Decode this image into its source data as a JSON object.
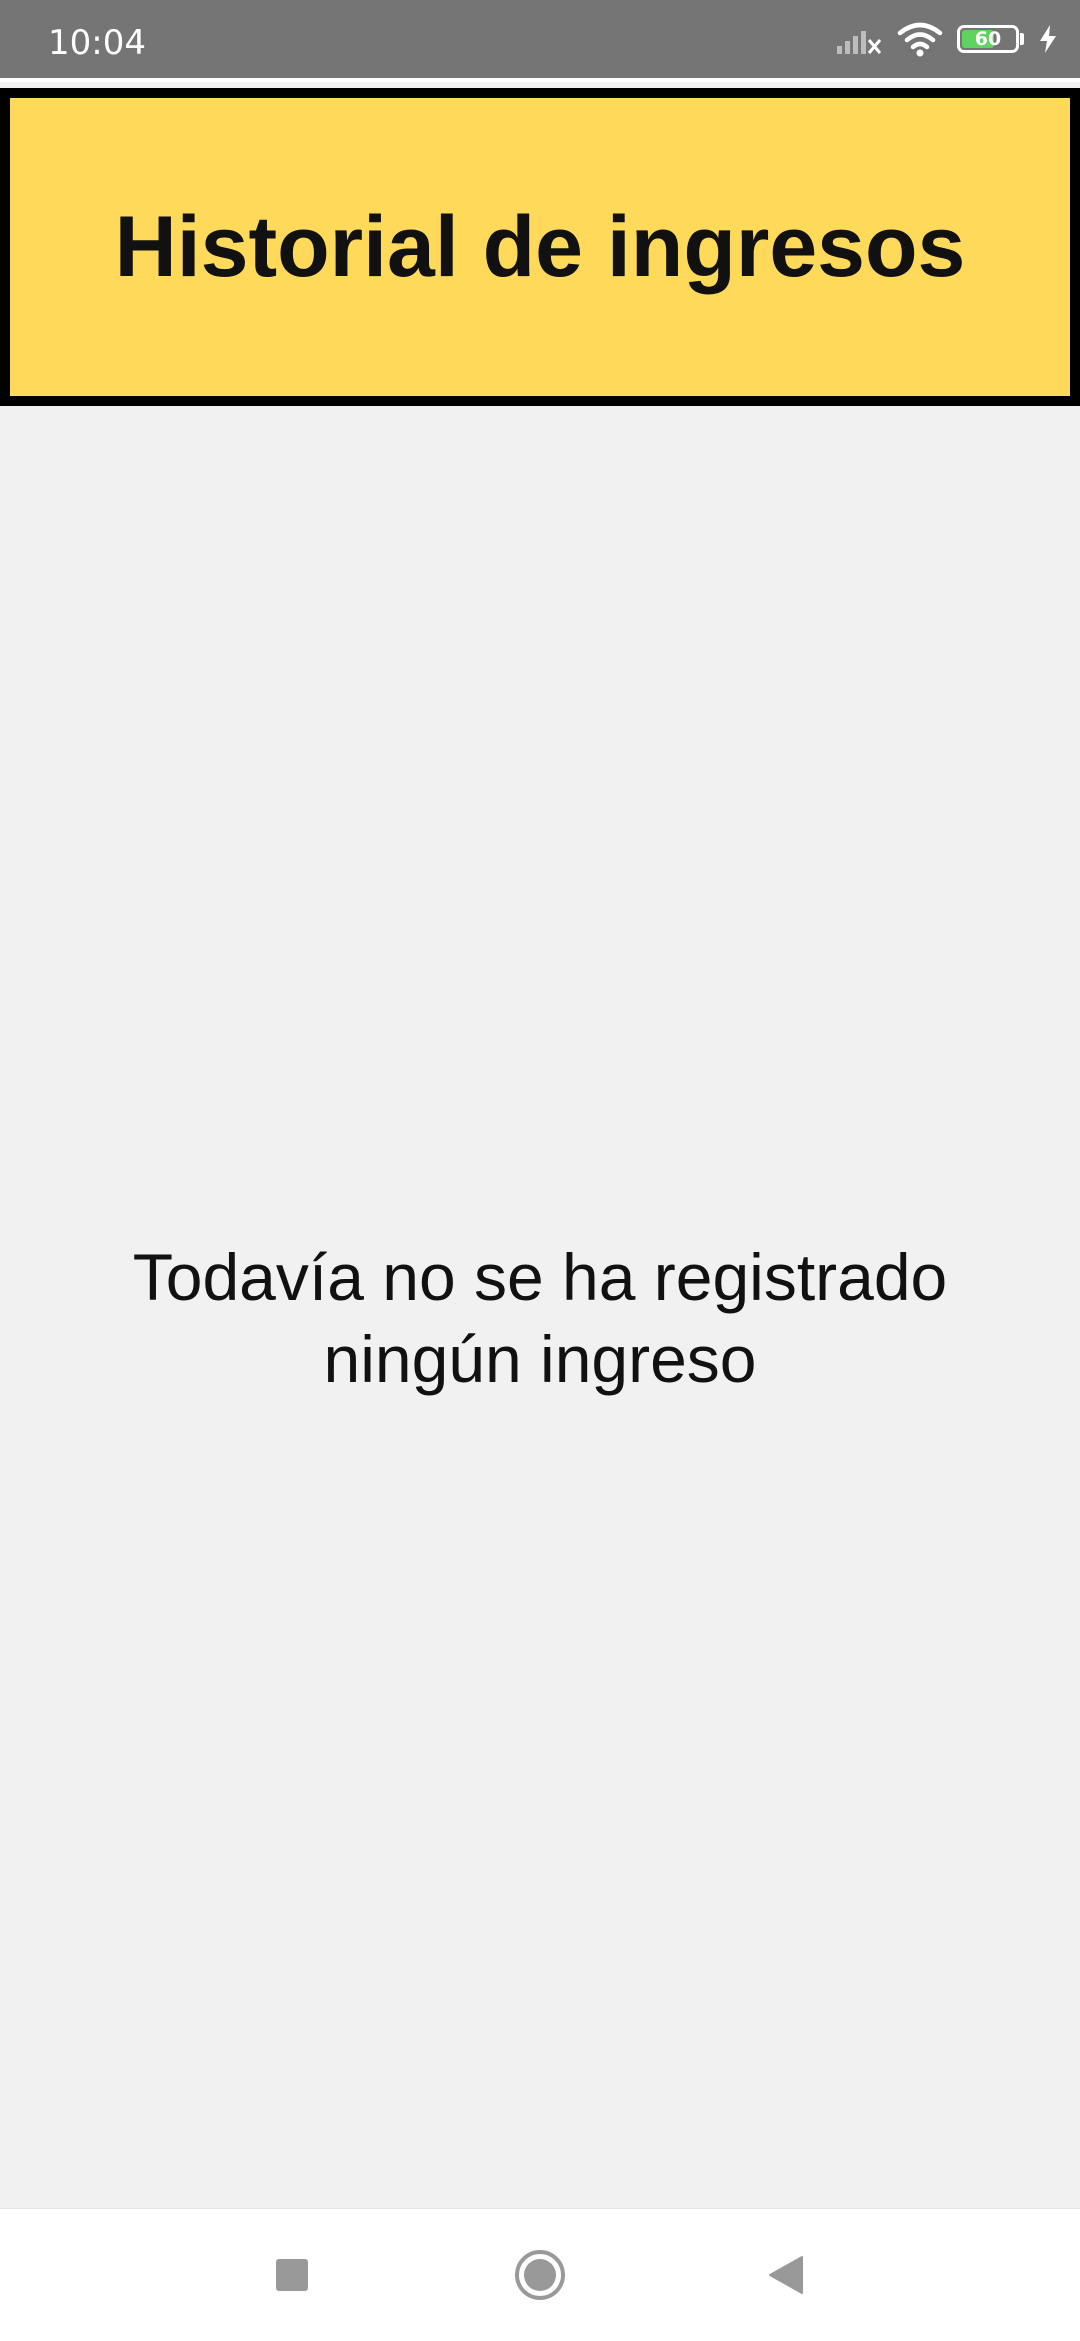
{
  "status_bar": {
    "time": "10:04",
    "icons": [
      "signal-off-icon",
      "wifi-icon",
      "battery-icon",
      "charging-icon"
    ],
    "battery_level": "60",
    "background_color": "#757575"
  },
  "header": {
    "title": "Historial de ingresos",
    "background_color": "#ffd95a",
    "border_color": "#000000"
  },
  "main": {
    "empty_message_line1": "Todavía no se ha registrado",
    "empty_message_line2": "ningún ingreso",
    "background_color": "#f1f1f1"
  },
  "navigation_bar": {
    "buttons": [
      "recent-apps-icon",
      "home-icon",
      "back-icon"
    ]
  }
}
